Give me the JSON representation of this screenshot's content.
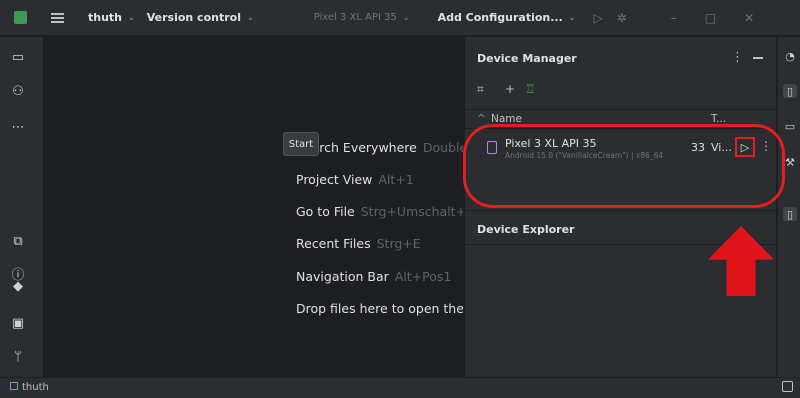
{
  "titlebar": {
    "project_name": "thuth",
    "vcs_label": "Version control",
    "device_selector": "Pixel 3 XL API 35",
    "run_config": "Add Configuration..."
  },
  "editor": {
    "hints": [
      {
        "label": "Search Everywhere",
        "shortcut": "Double Shift"
      },
      {
        "label": "Project View",
        "shortcut": "Alt+1"
      },
      {
        "label": "Go to File",
        "shortcut": "Strg+Umschalt+N"
      },
      {
        "label": "Recent Files",
        "shortcut": "Strg+E"
      },
      {
        "label": "Navigation Bar",
        "shortcut": "Alt+Pos1"
      },
      {
        "label": "Drop files here to open them",
        "shortcut": ""
      }
    ]
  },
  "device_manager": {
    "title": "Device Manager",
    "columns": {
      "name": "Name",
      "api": "",
      "type": "T..."
    },
    "device": {
      "name": "Pixel 3 XL API 35",
      "subtitle": "Android 15.0 (\"VanillaIceCream\") | x86_64",
      "api": "33",
      "type": "Vi..."
    },
    "tooltip": "Start",
    "explorer_title": "Device Explorer"
  },
  "statusbar": {
    "project": "thuth"
  },
  "colors": {
    "annotation_red": "#e02020",
    "background": "#1e1f22",
    "panel": "#2b2d30"
  }
}
